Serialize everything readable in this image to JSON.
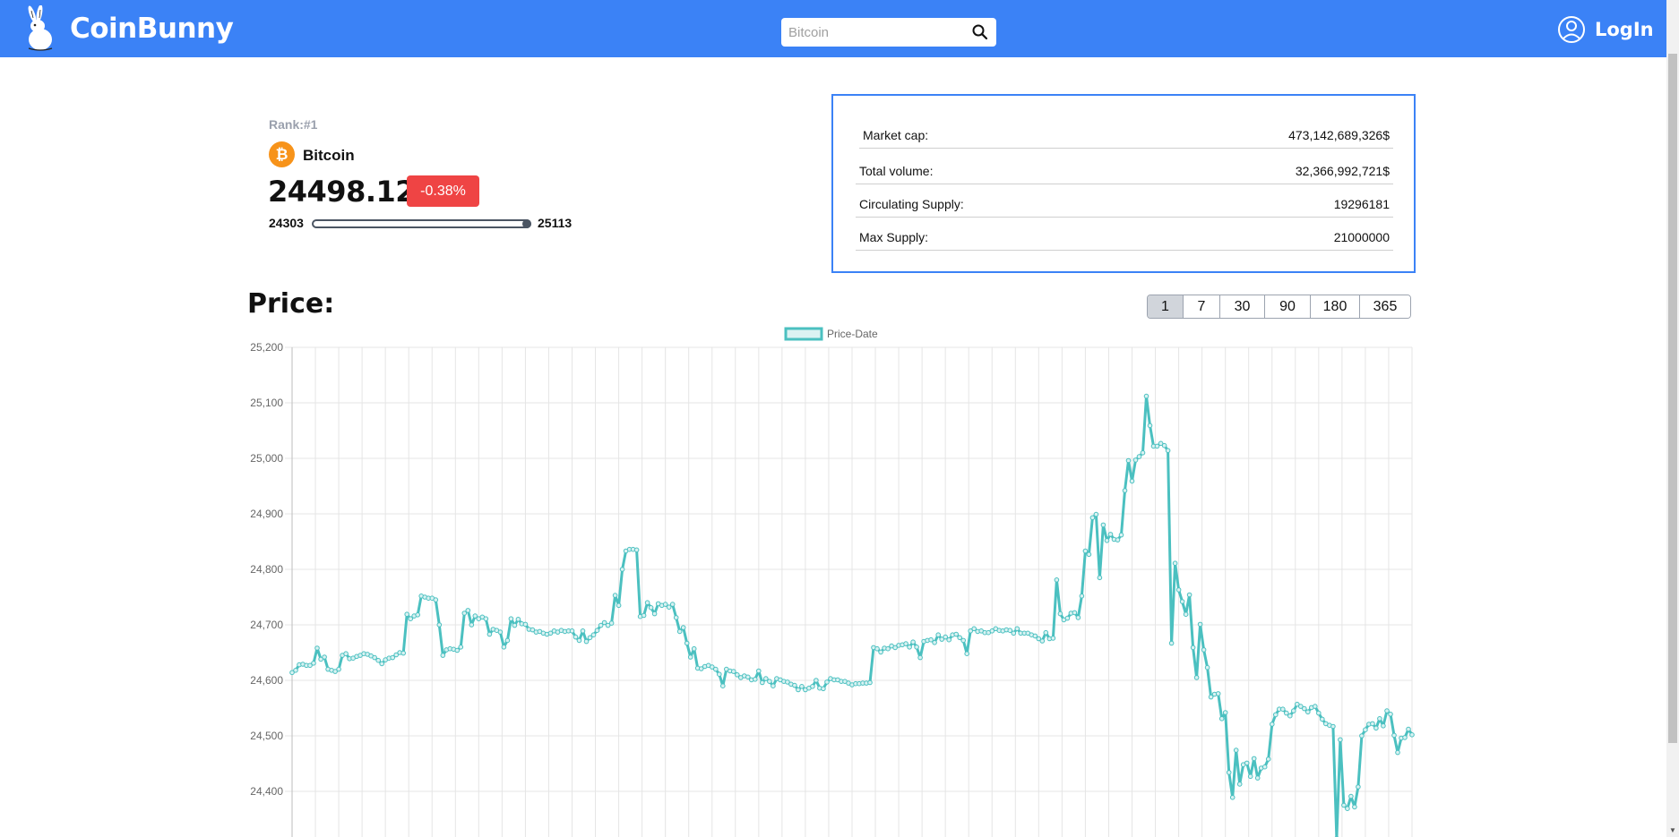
{
  "header": {
    "brand": "CoinBunny",
    "search_placeholder": "Bitcoin",
    "login_label": "LogIn",
    "bg_color": "#3b82f6"
  },
  "coin": {
    "rank": "Rank:#1",
    "name": "Bitcoin",
    "icon_symbol": "₿",
    "price": "24498.12$",
    "change": "-0.38%",
    "low": "24303",
    "high": "25113",
    "change_color": "#ef4444"
  },
  "stats": [
    {
      "label": "Market cap:",
      "value": "473,142,689,326$"
    },
    {
      "label": "Total volume:",
      "value": "32,366,992,721$"
    },
    {
      "label": "Circulating Supply:",
      "value": "19296181"
    },
    {
      "label": "Max Supply:",
      "value": "21000000"
    }
  ],
  "price_section": {
    "title": "Price:",
    "periods": [
      "1",
      "7",
      "30",
      "90",
      "180",
      "365"
    ],
    "selected_period": "1"
  },
  "chart_data": {
    "type": "line",
    "series": [
      {
        "name": "Price-Date",
        "color": "#4bc0c0",
        "values": [
          24614,
          24618,
          24628,
          24629,
          24627,
          24627,
          24631,
          24658,
          24638,
          24642,
          24620,
          24618,
          24616,
          24620,
          24645,
          24648,
          24639,
          24640,
          24643,
          24645,
          24648,
          24647,
          24644,
          24641,
          24636,
          24630,
          24637,
          24640,
          24641,
          24646,
          24650,
          24649,
          24719,
          24711,
          24716,
          24718,
          24752,
          24750,
          24748,
          24748,
          24745,
          24700,
          24645,
          24655,
          24657,
          24656,
          24654,
          24660,
          24721,
          24726,
          24700,
          24716,
          24711,
          24714,
          24711,
          24683,
          24692,
          24690,
          24687,
          24660,
          24672,
          24711,
          24699,
          24710,
          24702,
          24701,
          24692,
          24691,
          24687,
          24688,
          24685,
          24683,
          24685,
          24689,
          24687,
          24690,
          24688,
          24689,
          24689,
          24678,
          24672,
          24689,
          24670,
          24677,
          24682,
          24690,
          24699,
          24704,
          24699,
          24703,
          24753,
          24735,
          24800,
          24833,
          24836,
          24836,
          24835,
          24715,
          24717,
          24740,
          24731,
          24720,
          24738,
          24735,
          24737,
          24732,
          24737,
          24713,
          24688,
          24695,
          24667,
          24642,
          24657,
          24622,
          24621,
          24625,
          24627,
          24624,
          24620,
          24611,
          24590,
          24620,
          24617,
          24616,
          24610,
          24605,
          24608,
          24606,
          24601,
          24602,
          24617,
          24596,
          24603,
          24598,
          24590,
          24603,
          24601,
          24598,
          24597,
          24593,
          24591,
          24583,
          24589,
          24583,
          24586,
          24589,
          24600,
          24586,
          24585,
          24597,
          24603,
          24601,
          24601,
          24598,
          24598,
          24595,
          24592,
          24594,
          24594,
          24595,
          24595,
          24596,
          24659,
          24657,
          24651,
          24658,
          24657,
          24662,
          24659,
          24663,
          24664,
          24666,
          24660,
          24669,
          24660,
          24641,
          24670,
          24672,
          24673,
          24668,
          24682,
          24674,
          24678,
          24673,
          24682,
          24683,
          24677,
          24672,
          24648,
          24689,
          24693,
          24688,
          24689,
          24686,
          24686,
          24689,
          24693,
          24690,
          24689,
          24691,
          24690,
          24685,
          24693,
          24685,
          24685,
          24685,
          24682,
          24680,
          24675,
          24671,
          24686,
          24675,
          24676,
          24781,
          24720,
          24709,
          24712,
          24721,
          24722,
          24713,
          24752,
          24833,
          24827,
          24893,
          24899,
          24785,
          24880,
          24852,
          24863,
          24854,
          24853,
          24862,
          24942,
          24996,
          24959,
          24997,
          25003,
          25010,
          25112,
          25059,
          25022,
          25022,
          25027,
          25023,
          25014,
          24667,
          24811,
          24763,
          24742,
          24719,
          24754,
          24659,
          24605,
          24701,
          24655,
          24623,
          24570,
          24575,
          24576,
          24531,
          24542,
          24434,
          24389,
          24474,
          24413,
          24448,
          24451,
          24427,
          24459,
          24424,
          24442,
          24444,
          24458,
          24521,
          24538,
          24548,
          24548,
          24541,
          24536,
          24545,
          24557,
          24553,
          24549,
          24543,
          24551,
          24553,
          24541,
          24530,
          24522,
          24519,
          24517,
          24315,
          24493,
          24375,
          24369,
          24391,
          24372,
          24408,
          24500,
          24511,
          24521,
          24522,
          24514,
          24531,
          24518,
          24545,
          24539,
          24501,
          24470,
          24496,
          24497,
          24512,
          24502
        ]
      }
    ],
    "legend": [
      "Price-Date"
    ],
    "legend_position": "top",
    "ylim": [
      24300,
      25200
    ],
    "yticks": [
      "25,200",
      "25,100",
      "25,000",
      "24,900",
      "24,800",
      "24,700",
      "24,600",
      "24,500",
      "24,400"
    ],
    "grid": true
  }
}
